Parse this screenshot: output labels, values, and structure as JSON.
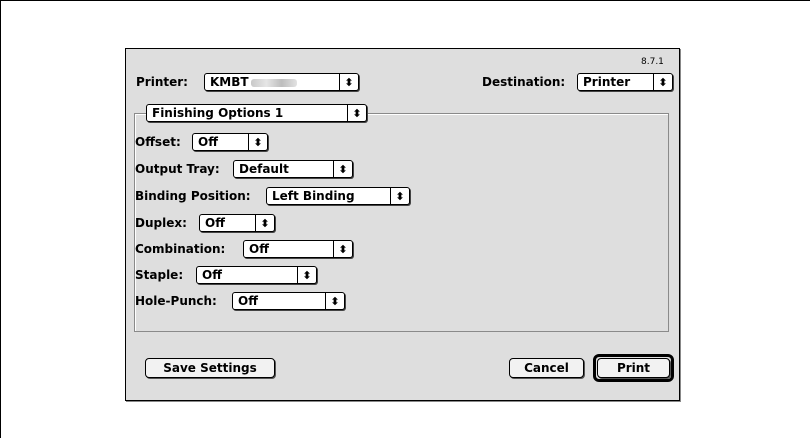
{
  "dialog": {
    "version": "8.7.1",
    "printer_label": "Printer:",
    "printer_value": "KMBT",
    "destination_label": "Destination:",
    "destination_value": "Printer",
    "panel_popup_value": "Finishing Options 1"
  },
  "options": {
    "offset_label": "Offset:",
    "offset_value": "Off",
    "output_tray_label": "Output Tray:",
    "output_tray_value": "Default",
    "binding_position_label": "Binding Position:",
    "binding_position_value": "Left Binding",
    "duplex_label": "Duplex:",
    "duplex_value": "Off",
    "combination_label": "Combination:",
    "combination_value": "Off",
    "staple_label": "Staple:",
    "staple_value": "Off",
    "hole_punch_label": "Hole-Punch:",
    "hole_punch_value": "Off"
  },
  "buttons": {
    "save_settings": "Save Settings",
    "cancel": "Cancel",
    "print": "Print"
  },
  "icons": {
    "popup_arrow": "updown-arrows-icon"
  },
  "arrow_glyph": "⬍"
}
